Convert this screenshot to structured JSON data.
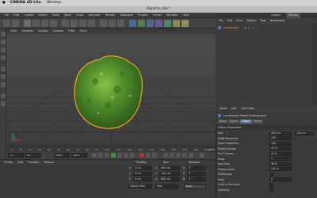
{
  "mac_menu": {
    "items": [
      "CINEMA 4D Lite",
      "Window"
    ]
  },
  "window": {
    "title": "Objects.c4d *"
  },
  "menubar": {
    "items": [
      "File",
      "Edit",
      "Create",
      "Select",
      "Tools",
      "Mesh",
      "Snap",
      "Animate",
      "Render",
      "MoGraph",
      "Plugins",
      "Script",
      "Window",
      "Help"
    ]
  },
  "viewport_menu": {
    "items": [
      "View",
      "Cameras",
      "Display",
      "Options",
      "Filter",
      "Panel"
    ]
  },
  "timeline": {
    "ticks": [
      "0",
      "10",
      "20",
      "30",
      "40",
      "50",
      "60",
      "70",
      "80",
      "90",
      "100",
      "110",
      "120",
      "130",
      "140",
      "150",
      "160",
      "170",
      "180",
      "190"
    ],
    "frame_field": "0 F",
    "start_field": "0 F",
    "end_field": "230 F",
    "current_field": "230 F",
    "current_frame": "190 F"
  },
  "material_menu": {
    "items": [
      "Create",
      "Edit",
      "Function",
      "Texture"
    ]
  },
  "coords": {
    "headers": [
      "Position",
      "Size",
      "Rotation"
    ],
    "rows": [
      {
        "axis": "X",
        "pos": "0 cm",
        "size_axis": "X",
        "size": "800 cm",
        "rot_axis": "H",
        "rot": "0 °"
      },
      {
        "axis": "Y",
        "pos": "0 cm",
        "size_axis": "Y",
        "size": "100 cm",
        "rot_axis": "P",
        "rot": "0 °"
      },
      {
        "axis": "Z",
        "pos": "0 cm",
        "size_axis": "Z",
        "size": "800 cm",
        "rot_axis": "B",
        "rot": "0 °"
      }
    ],
    "mode_select": "Object (Rel)",
    "size_select": "Size",
    "apply_button": "Apply"
  },
  "right_tabs": {
    "items": [
      "Layout:",
      "Startup"
    ]
  },
  "object_manager": {
    "menu": [
      "File",
      "Edit",
      "View",
      "Objects",
      "Tags",
      "Bookmarks"
    ],
    "objects": [
      {
        "name": "Landscape"
      }
    ]
  },
  "attributes": {
    "menu": [
      "Mode",
      "Edit",
      "User Data"
    ],
    "tabs": [
      "Basic",
      "Coord.",
      "Object",
      "Phong"
    ],
    "active_tab": "Object",
    "header": "Landscape Object [Landscape]",
    "section": "Object Properties",
    "properties": [
      {
        "label": "Size",
        "value": "800 cm",
        "value2": "100 cm"
      },
      {
        "label": "Width Segments",
        "value": "100",
        "value2": ""
      },
      {
        "label": "Depth Segments",
        "value": "100",
        "value2": ""
      },
      {
        "label": "Rough Furrows",
        "value": "47 %",
        "value2": ""
      },
      {
        "label": "Fine Furrows",
        "value": "41 %",
        "value2": ""
      },
      {
        "label": "Scale",
        "value": "1",
        "value2": ""
      },
      {
        "label": "Sea Level",
        "value": "38 %",
        "value2": ""
      },
      {
        "label": "Plateau Level",
        "value": "100 %",
        "value2": ""
      },
      {
        "label": "Multifractal",
        "value": "",
        "value2": ""
      },
      {
        "label": "Seed",
        "value": "0",
        "value2": ""
      },
      {
        "label": "Limit to Sea Level",
        "value": "",
        "value2": ""
      },
      {
        "label": "Spherical",
        "value": "",
        "value2": ""
      }
    ]
  },
  "colors": {
    "accent": "#5a6fa0",
    "selection_outline": "#f0a030",
    "landscape_green": "#5a8a2a"
  }
}
